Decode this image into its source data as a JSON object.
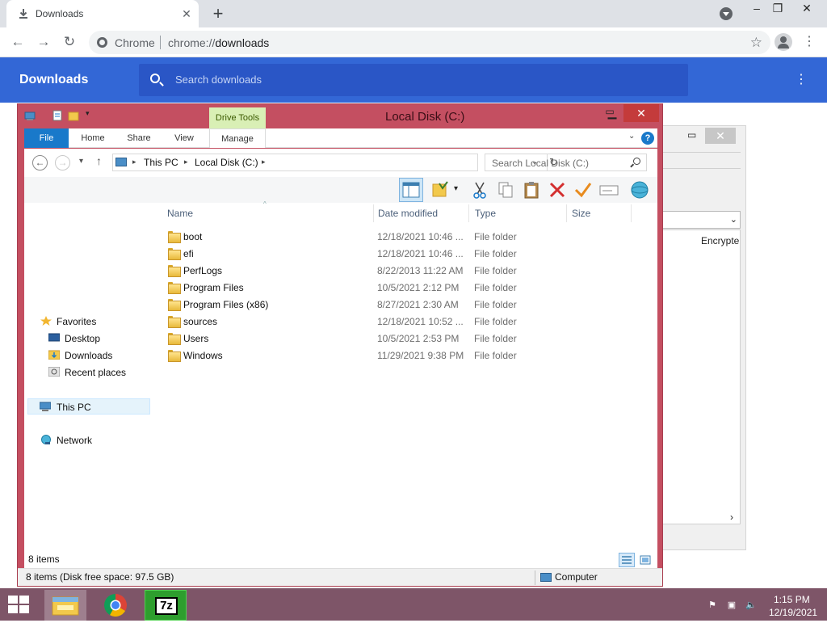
{
  "chrome": {
    "tab_title": "Downloads",
    "tab_close": "✕",
    "new_tab": "+",
    "omnibox_scheme": "Chrome",
    "omnibox_url_prefix": "chrome://",
    "omnibox_url_path": "downloads",
    "page_title": "Downloads",
    "search_placeholder": "Search downloads",
    "accent": "#3367d6"
  },
  "bg_window": {
    "column_label": "Encrypte"
  },
  "explorer": {
    "title": "Local Disk (C:)",
    "contextual_tab": "Drive Tools",
    "ribbon_tabs": [
      "File",
      "Home",
      "Share",
      "View",
      "Manage"
    ],
    "breadcrumbs": [
      "This PC",
      "Local Disk (C:)"
    ],
    "search_placeholder": "Search Local Disk (C:)",
    "nav": {
      "favorites": "Favorites",
      "desktop": "Desktop",
      "downloads": "Downloads",
      "recent": "Recent places",
      "this_pc": "This PC",
      "network": "Network"
    },
    "columns": [
      "Name",
      "Date modified",
      "Type",
      "Size"
    ],
    "rows": [
      {
        "name": "boot",
        "date": "12/18/2021 10:46 ...",
        "type": "File folder"
      },
      {
        "name": "efi",
        "date": "12/18/2021 10:46 ...",
        "type": "File folder"
      },
      {
        "name": "PerfLogs",
        "date": "8/22/2013 11:22 AM",
        "type": "File folder"
      },
      {
        "name": "Program Files",
        "date": "10/5/2021 2:12 PM",
        "type": "File folder"
      },
      {
        "name": "Program Files (x86)",
        "date": "8/27/2021 2:30 AM",
        "type": "File folder"
      },
      {
        "name": "sources",
        "date": "12/18/2021 10:52 ...",
        "type": "File folder"
      },
      {
        "name": "Users",
        "date": "10/5/2021 2:53 PM",
        "type": "File folder"
      },
      {
        "name": "Windows",
        "date": "11/29/2021 9:38 PM",
        "type": "File folder"
      }
    ],
    "item_count": "8 items",
    "status_left": "8 items (Disk free space: 97.5 GB)",
    "status_right": "Computer",
    "frame_color": "#c44f61"
  },
  "taskbar": {
    "time": "1:15 PM",
    "date": "12/19/2021",
    "apps": [
      "file-explorer",
      "chrome",
      "7-zip"
    ],
    "sevenzip_label": "7z"
  }
}
